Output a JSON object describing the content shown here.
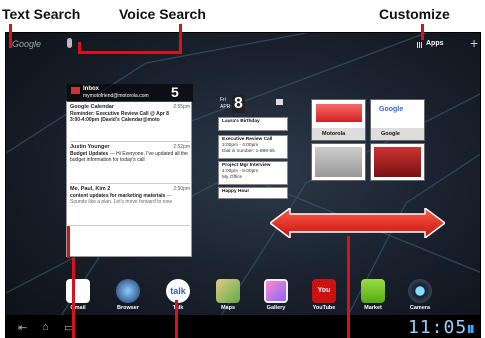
{
  "callouts": {
    "text_search": "Text Search",
    "voice_search": "Voice Search",
    "customize": "Customize"
  },
  "topbar": {
    "search_logo": "Google",
    "apps_label": "Apps"
  },
  "gmail_widget": {
    "title": "Inbox",
    "account": "mymotofriend@motorola.com",
    "unread_count": "5",
    "messages": [
      {
        "from": "Google Calendar",
        "time": "2:55pm",
        "subject": "Reminder: Executive Review Call @ Apr 8",
        "snippet": "3:00-4:00pm (David's Calendar@moto"
      },
      {
        "from": "Justin Younger",
        "time": "2:52pm",
        "subject": "Budget Updates",
        "snippet": "— Hi Everyone, I've updated all the budget information for today's call"
      },
      {
        "from": "Me, Paul, Kim 2",
        "time": "2:50pm",
        "subject": "content updates for marketing materials",
        "snippet": "— Sounds like a plan. Let's move forward to now"
      }
    ]
  },
  "calendar_widget": {
    "day": "Fri",
    "month": "APR",
    "date": "8",
    "events": [
      {
        "title": "Laura's Birthday",
        "detail": ""
      },
      {
        "title": "Executive Review Call",
        "detail": "3:00pm - 4:00pm",
        "extra": "Dial in number: 1-888-55"
      },
      {
        "title": "Project Mgr Interview",
        "detail": "4:00pm - 5:00pm",
        "extra": "My Office"
      },
      {
        "title": "Happy Hour",
        "detail": ""
      }
    ]
  },
  "bookmarks": [
    {
      "label": "Motorola"
    },
    {
      "label": "Google"
    }
  ],
  "dock": [
    {
      "label": "Gmail",
      "icon": "gmail-icon"
    },
    {
      "label": "Browser",
      "icon": "browser-icon"
    },
    {
      "label": "Talk",
      "icon": "talk-icon"
    },
    {
      "label": "Maps",
      "icon": "maps-icon"
    },
    {
      "label": "Gallery",
      "icon": "gallery-icon"
    },
    {
      "label": "YouTube",
      "icon": "youtube-icon"
    },
    {
      "label": "Market",
      "icon": "market-icon"
    },
    {
      "label": "Camera",
      "icon": "camera-icon"
    }
  ],
  "system_bar": {
    "clock": "11:05"
  },
  "colors": {
    "callout_line": "#d6121b",
    "arrow": "#e0231c",
    "clock": "#99ccff"
  }
}
